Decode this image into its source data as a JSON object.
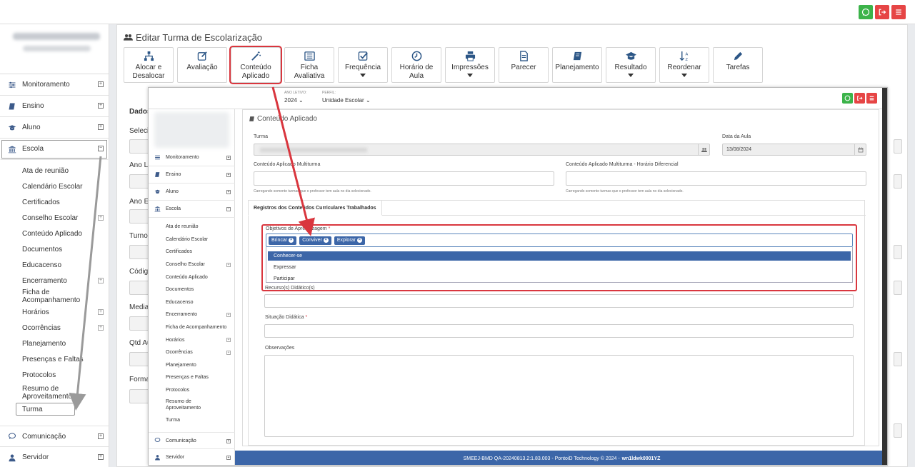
{
  "main": {
    "title": "Editar Turma de Escolarização",
    "tab_stub": "Dados",
    "outer_labels": [
      "Selecio",
      "Ano Le",
      "Ano Es",
      "Turno",
      "Código",
      "Mediac",
      "Qtd Au",
      "Formas"
    ],
    "toolbar": [
      {
        "label": "Alocar e Desalocar",
        "icon": "sitemap-icon",
        "caret": false,
        "highlight": false
      },
      {
        "label": "Avaliação",
        "icon": "edit-icon",
        "caret": false,
        "highlight": false
      },
      {
        "label": "Conteúdo Aplicado",
        "icon": "magic-wand-icon",
        "caret": false,
        "highlight": true
      },
      {
        "label": "Ficha Avaliativa",
        "icon": "list-icon",
        "caret": false,
        "highlight": false
      },
      {
        "label": "Frequência",
        "icon": "check-square-icon",
        "caret": true,
        "highlight": false
      },
      {
        "label": "Horário de Aula",
        "icon": "clock-icon",
        "caret": false,
        "highlight": false
      },
      {
        "label": "Impressões",
        "icon": "print-icon",
        "caret": true,
        "highlight": false
      },
      {
        "label": "Parecer",
        "icon": "file-icon",
        "caret": false,
        "highlight": false
      },
      {
        "label": "Planejamento",
        "icon": "book-icon",
        "caret": false,
        "highlight": false
      },
      {
        "label": "Resultado",
        "icon": "graduation-cap-icon",
        "caret": true,
        "highlight": false
      },
      {
        "label": "Reordenar",
        "icon": "sort-alpha-icon",
        "caret": true,
        "highlight": false
      },
      {
        "label": "Tarefas",
        "icon": "pencil-icon",
        "caret": false,
        "highlight": false
      }
    ]
  },
  "sidebar": {
    "items": [
      {
        "label": "Monitoramento",
        "icon": "sliders-icon"
      },
      {
        "label": "Ensino",
        "icon": "book-icon"
      },
      {
        "label": "Aluno",
        "icon": "graduation-cap-icon"
      },
      {
        "label": "Escola",
        "icon": "bank-icon"
      }
    ],
    "escola_sub": [
      {
        "label": "Ata de reunião",
        "expand": false
      },
      {
        "label": "Calendário Escolar",
        "expand": false
      },
      {
        "label": "Certificados",
        "expand": false
      },
      {
        "label": "Conselho Escolar",
        "expand": true
      },
      {
        "label": "Conteúdo Aplicado",
        "expand": false
      },
      {
        "label": "Documentos",
        "expand": false
      },
      {
        "label": "Educacenso",
        "expand": false
      },
      {
        "label": "Encerramento",
        "expand": true
      },
      {
        "label": "Ficha de Acompanhamento",
        "expand": false
      },
      {
        "label": "Horários",
        "expand": true
      },
      {
        "label": "Ocorrências",
        "expand": true
      },
      {
        "label": "Planejamento",
        "expand": false
      },
      {
        "label": "Presenças e Faltas",
        "expand": false
      },
      {
        "label": "Protocolos",
        "expand": false
      },
      {
        "label": "Resumo de Aproveitamento",
        "expand": false
      },
      {
        "label": "Turma",
        "expand": false
      }
    ],
    "bottom": [
      {
        "label": "Comunicação",
        "icon": "chat-icon"
      },
      {
        "label": "Servidor",
        "icon": "user-icon"
      }
    ]
  },
  "popup": {
    "ano_letivo_label": "ANO LETIVO:",
    "ano_letivo_value": "2024",
    "perfil_label": "PERFIL:",
    "perfil_value": "Unidade Escolar",
    "title": "Conteúdo Aplicado",
    "turma_label": "Turma",
    "data_label": "Data da Aula",
    "data_value": "13/08/2024",
    "multiturma_label": "Conteúdo Aplicado Multiturma",
    "multiturma_hd_label": "Conteúdo Aplicado Multiturma - Horário Diferencial",
    "hint": "Carregando somente turmas que o professor tem aula no dia selecionado.",
    "tab_label": "Registros dos Conteúdos Curriculares Trabalhados",
    "objetivos_label": "Objetivos de Aprendizagem",
    "chips": [
      "Brincar",
      "Conviver",
      "Explorar"
    ],
    "options": [
      "Conhecer-se",
      "Expressar",
      "Participar"
    ],
    "recursos_label": "Recurso(s) Didático(s)",
    "situacao_label": "Situação Didática",
    "observacoes_label": "Observações",
    "footer_text": "SMEEJ-BMD QA-20240813.2:1.83.003 - PontoiD Technology © 2024 -",
    "footer_bold": "wn1ldwk0001YZ"
  },
  "colors": {
    "accent": "#3c66a8",
    "highlight_red": "#d9363e",
    "whatsapp_green": "#3cb34a",
    "danger_red": "#e64545"
  }
}
